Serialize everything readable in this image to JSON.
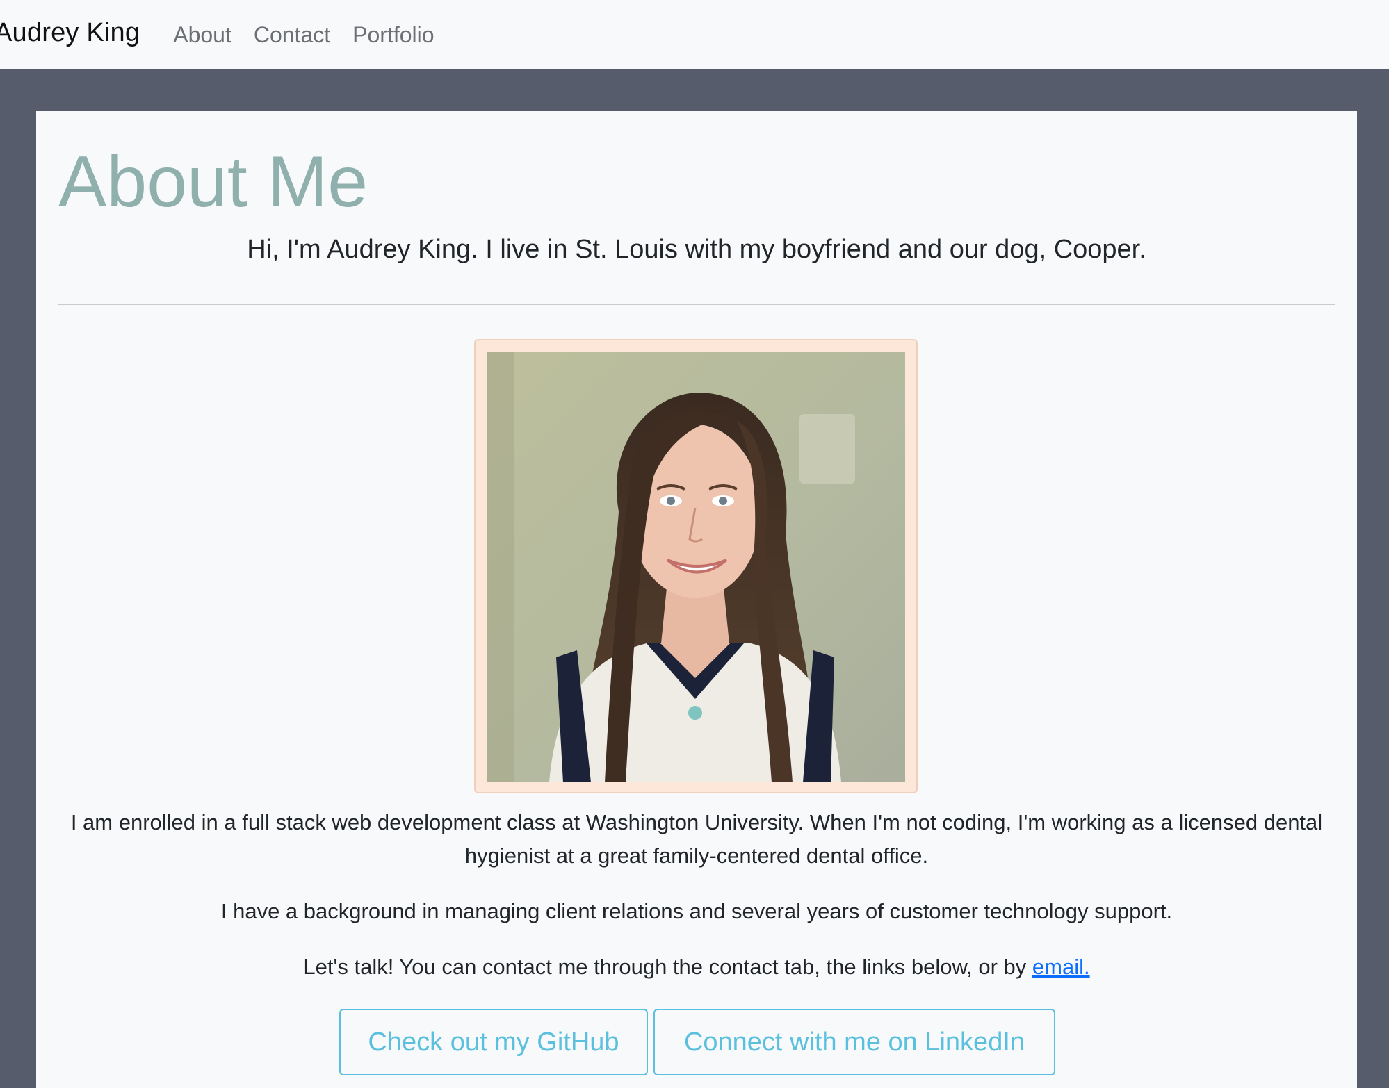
{
  "navbar": {
    "brand": "Audrey King",
    "links": [
      "About",
      "Contact",
      "Portfolio"
    ]
  },
  "main": {
    "title": "About Me",
    "lead": "Hi, I'm Audrey King. I live in St. Louis with my boyfriend and our dog, Cooper.",
    "paragraphs": [
      "I am enrolled in a full stack web development class at Washington University. When I'm not coding, I'm working as a licensed dental hygienist at a great family-centered dental office.",
      "I have a background in managing client relations and several years of customer technology support."
    ],
    "contact_text": "Let's talk! You can contact me through the contact tab, the links below, or by",
    "email_link": "email.",
    "buttons": {
      "github": "Check out my GitHub",
      "linkedin": "Connect with me on LinkedIn"
    }
  },
  "colors": {
    "navbar_bg": "#f8f9fa",
    "page_bg": "#575c6d",
    "title": "#8fb0ad",
    "button_outline": "#5bc0de",
    "photo_frame": "#fde7d9",
    "link": "#0d6efd"
  }
}
